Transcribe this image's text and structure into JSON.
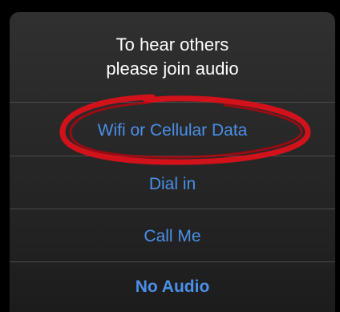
{
  "dialog": {
    "title_line1": "To hear others",
    "title_line2": "please join audio",
    "options": [
      {
        "label": "Wifi or Cellular Data",
        "highlighted": true
      },
      {
        "label": "Dial in"
      },
      {
        "label": "Call Me"
      },
      {
        "label": "No Audio",
        "emphasized": true
      }
    ]
  },
  "colors": {
    "option_text": "#4a90e8",
    "highlight_circle": "#e0101a",
    "background": "#2a2a2a"
  }
}
